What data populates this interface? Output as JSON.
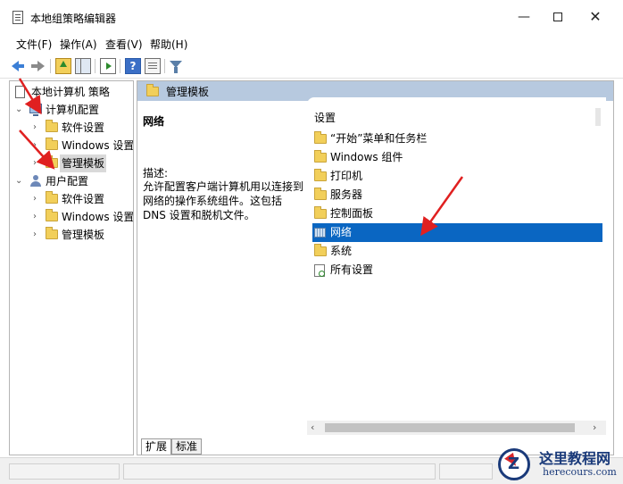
{
  "window": {
    "title": "本地组策略编辑器",
    "min_glyph": "—",
    "close_glyph": "✕"
  },
  "menu": [
    "文件(F)",
    "操作(A)",
    "查看(V)",
    "帮助(H)"
  ],
  "toolbar_icons": [
    "back-arrow-icon",
    "forward-arrow-icon",
    "up-folder-icon",
    "show-hide-pane-icon",
    "export-list-icon",
    "help-icon",
    "properties-icon",
    "filter-icon"
  ],
  "tree": {
    "root": "本地计算机 策略",
    "computer_config": "计算机配置",
    "computer_children": [
      "软件设置",
      "Windows 设置",
      "管理模板"
    ],
    "user_config": "用户配置",
    "user_children": [
      "软件设置",
      "Windows 设置",
      "管理模板"
    ],
    "expanded_glyph": "⌄",
    "collapsed_glyph": "›"
  },
  "right": {
    "header_title": "管理模板",
    "desc_title": "网络",
    "desc_label": "描述:",
    "desc_text": "允许配置客户端计算机用以连接到网络的操作系统组件。这包括 DNS 设置和脱机文件。",
    "list_header": "设置",
    "items": [
      "“开始”菜单和任务栏",
      "Windows 组件",
      "打印机",
      "服务器",
      "控制面板",
      "网络",
      "系统",
      "所有设置"
    ],
    "selected_item": "网络"
  },
  "tabs": [
    "扩展",
    "标准"
  ],
  "scroll_glyphs": {
    "left": "‹",
    "right": "›"
  },
  "watermark": {
    "title": "这里教程网",
    "url": "herecours.com",
    "logo_letter": "Z"
  },
  "colors": {
    "selection": "#0a66c2",
    "header_band": "#b7c9df",
    "annotation_arrow": "#e02020"
  }
}
